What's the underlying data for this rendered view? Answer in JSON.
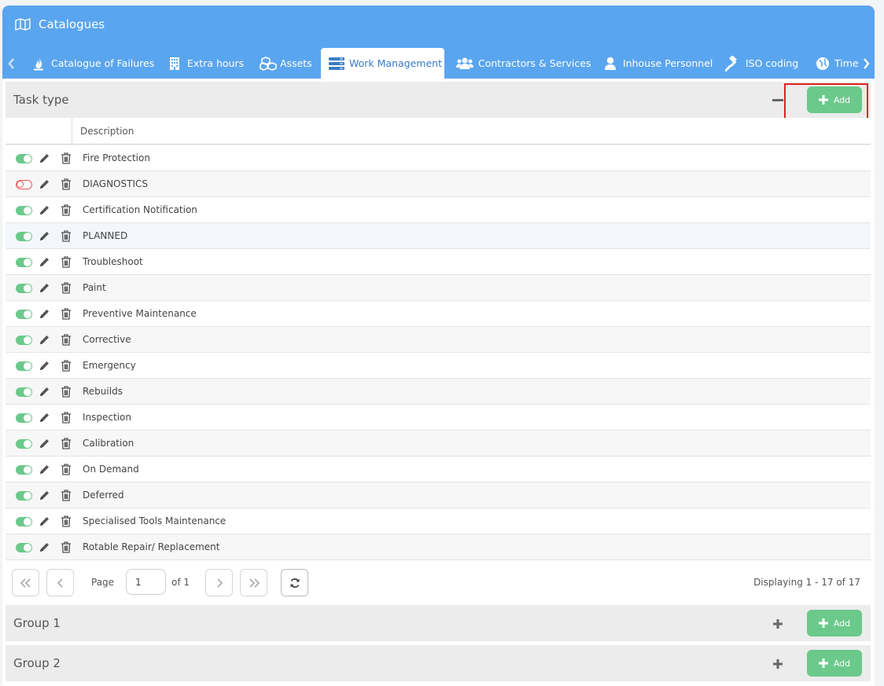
{
  "window": {
    "title": "Catalogues"
  },
  "tabs": [
    {
      "label": "Catalogue of Failures",
      "icon": "flame-icon",
      "active": false
    },
    {
      "label": "Extra hours",
      "icon": "building-icon",
      "active": false
    },
    {
      "label": "Assets",
      "icon": "cubes-icon",
      "active": false
    },
    {
      "label": "Work Management",
      "icon": "server-icon",
      "active": true
    },
    {
      "label": "Contractors & Services",
      "icon": "users-icon",
      "active": false
    },
    {
      "label": "Inhouse Personnel",
      "icon": "user-icon",
      "active": false
    },
    {
      "label": "ISO coding",
      "icon": "gavel-icon",
      "active": false
    },
    {
      "label": "Time",
      "icon": "globe-icon",
      "active": false
    }
  ],
  "task_panel": {
    "title": "Task type",
    "add_label": "Add",
    "column_header": "Description",
    "rows": [
      {
        "description": "Fire Protection",
        "enabled": true
      },
      {
        "description": "DIAGNOSTICS",
        "enabled": false
      },
      {
        "description": "Certification Notification",
        "enabled": true
      },
      {
        "description": "PLANNED",
        "enabled": true
      },
      {
        "description": "Troubleshoot",
        "enabled": true
      },
      {
        "description": "Paint",
        "enabled": true
      },
      {
        "description": "Preventive Maintenance",
        "enabled": true
      },
      {
        "description": "Corrective",
        "enabled": true
      },
      {
        "description": "Emergency",
        "enabled": true
      },
      {
        "description": "Rebuilds",
        "enabled": true
      },
      {
        "description": "Inspection",
        "enabled": true
      },
      {
        "description": "Calibration",
        "enabled": true
      },
      {
        "description": "On Demand",
        "enabled": true
      },
      {
        "description": "Deferred",
        "enabled": true
      },
      {
        "description": "Specialised Tools Maintenance",
        "enabled": true
      },
      {
        "description": "Rotable Repair/ Replacement",
        "enabled": true
      }
    ]
  },
  "pager": {
    "page_label": "Page",
    "page_value": "1",
    "of_label": "of 1",
    "displaying": "Displaying 1 - 17 of 17"
  },
  "groups": [
    {
      "title": "Group 1",
      "add_label": "Add"
    },
    {
      "title": "Group 2",
      "add_label": "Add"
    }
  ],
  "colors": {
    "header_blue": "#5aa5ef",
    "add_green": "#6bc98b",
    "toggle_off_red": "#e85a5a",
    "highlight_red": "#e02020"
  }
}
